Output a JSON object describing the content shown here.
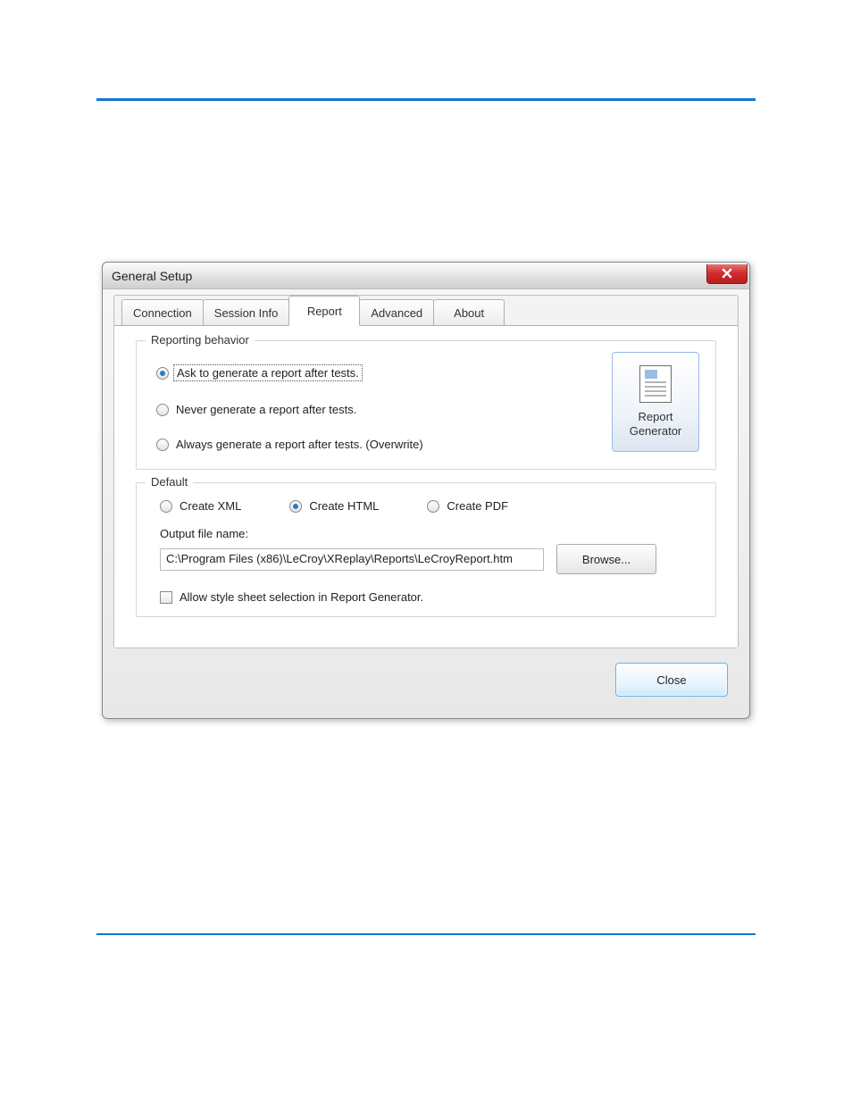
{
  "window": {
    "title": "General Setup"
  },
  "tabs": [
    {
      "label": "Connection",
      "active": false
    },
    {
      "label": "Session Info",
      "active": false
    },
    {
      "label": "Report",
      "active": true
    },
    {
      "label": "Advanced",
      "active": false
    },
    {
      "label": "About",
      "active": false
    }
  ],
  "reporting_behavior": {
    "legend": "Reporting behavior",
    "options": [
      {
        "label": "Ask to generate a report after tests.",
        "checked": true,
        "focused": true
      },
      {
        "label": "Never generate a report after tests.",
        "checked": false,
        "focused": false
      },
      {
        "label": "Always generate a report after tests. (Overwrite)",
        "checked": false,
        "focused": false
      }
    ],
    "big_button": {
      "line1": "Report",
      "line2": "Generator"
    }
  },
  "default_section": {
    "legend": "Default",
    "formats": [
      {
        "label": "Create XML",
        "checked": false
      },
      {
        "label": "Create HTML",
        "checked": true
      },
      {
        "label": "Create PDF",
        "checked": false
      }
    ],
    "output_label": "Output file name:",
    "output_value": "C:\\Program Files (x86)\\LeCroy\\XReplay\\Reports\\LeCroyReport.htm",
    "browse_label": "Browse...",
    "stylesheet_checkbox": {
      "label": "Allow style sheet selection in Report Generator.",
      "checked": false
    }
  },
  "footer": {
    "close_label": "Close"
  }
}
